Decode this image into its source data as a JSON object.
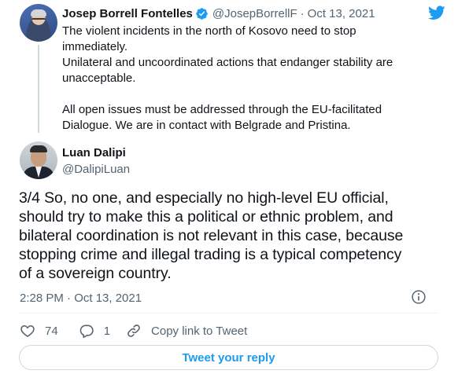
{
  "parent_tweet": {
    "author_name": "Josep Borrell Fontelles",
    "handle": "@JosepBorrellF",
    "separator": "·",
    "date": "Oct 13, 2021",
    "verified_icon": "verified-badge-icon",
    "paragraphs": [
      "The violent incidents in the north of Kosovo need to stop",
      "immediately.",
      "Unilateral and uncoordinated actions that endanger stability are",
      "unacceptable.",
      "",
      "All open issues must be addressed through the EU-facilitated",
      "Dialogue. We are in contact with Belgrade and Pristina."
    ]
  },
  "main_tweet": {
    "author_name": "Luan Dalipi",
    "handle": "@DalipiLuan",
    "lines": [
      "3/4 So, no one, and especially no high-level EU official,",
      "should try to make this a political or ethnic problem, and",
      "bilateral coordination is not relevant in this case, because",
      "stopping crime and illegal trading is a typical competency",
      "of a sovereign country."
    ],
    "timestamp": "2:28 PM · Oct 13, 2021"
  },
  "actions": {
    "like_count": "74",
    "reply_count": "1",
    "copy_link_label": "Copy link to Tweet"
  },
  "reply_button_label": "Tweet your reply",
  "colors": {
    "accent": "#1d9bf0",
    "text": "#0f1419",
    "secondary": "#536471",
    "border": "#cfd9de"
  }
}
